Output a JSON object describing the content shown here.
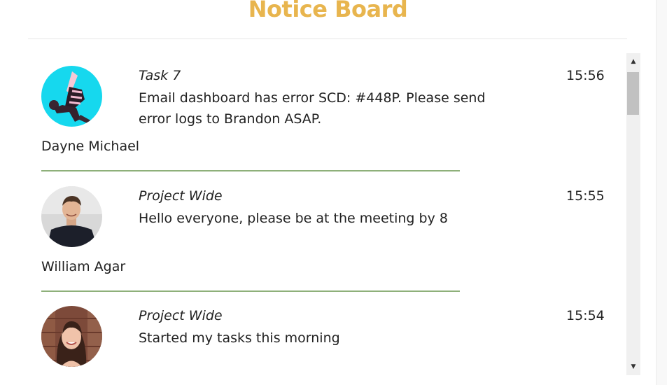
{
  "page": {
    "title": "Notice Board"
  },
  "posts": [
    {
      "tag": "Task 7",
      "message": "Email dashboard has error SCD: #448P. Please send error logs to Brandon ASAP.",
      "time": "15:56",
      "author": "Dayne Michael",
      "avatar_icon": "person-dancing-avatar"
    },
    {
      "tag": "Project Wide",
      "message": "Hello everyone, please be at the meeting by 8",
      "time": "15:55",
      "author": "William Agar",
      "avatar_icon": "person-portrait-avatar"
    },
    {
      "tag": "Project Wide",
      "message": "Started my tasks this morning",
      "time": "15:54",
      "author": "",
      "avatar_icon": "person-portrait-avatar"
    }
  ],
  "scrollbar": {
    "up_icon": "▲",
    "down_icon": "▼"
  },
  "colors": {
    "title": "#e8b54e",
    "divider": "#8eb07a"
  }
}
